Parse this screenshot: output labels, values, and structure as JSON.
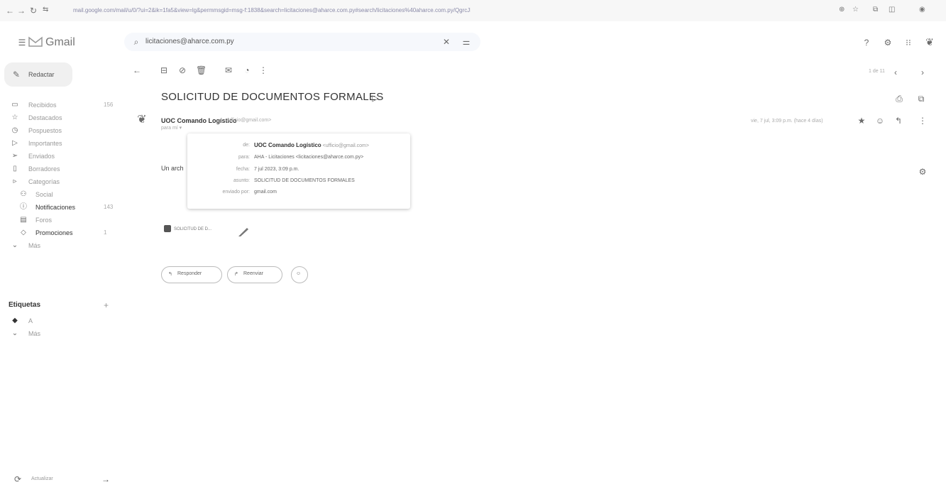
{
  "browser": {
    "url": "mail.google.com/mail/u/0/?ui=2&ik=1fa5&view=lg&permmsgid=msg-f:1838&search=licitaciones@aharce.com.py#search/licitaciones%40aharce.com.py/QgrcJHrThr..."
  },
  "app": {
    "title": "Gmail"
  },
  "search": {
    "value": "licitaciones@aharce.com.py"
  },
  "compose": {
    "label": "Redactar"
  },
  "sidebar": {
    "items": [
      {
        "label": "Recibidos",
        "count": "156",
        "icon": "inbox-icon"
      },
      {
        "label": "Destacados",
        "count": "",
        "icon": "star-icon"
      },
      {
        "label": "Pospuestos",
        "count": "",
        "icon": "clock-icon"
      },
      {
        "label": "Importantes",
        "count": "",
        "icon": "important-icon"
      },
      {
        "label": "Enviados",
        "count": "",
        "icon": "send-icon"
      },
      {
        "label": "Borradores",
        "count": "",
        "icon": "draft-icon"
      },
      {
        "label": "Categorías",
        "count": "",
        "icon": "category-icon"
      }
    ],
    "categories": [
      {
        "label": "Social",
        "count": "",
        "icon": "people-icon"
      },
      {
        "label": "Notificaciones",
        "count": "143",
        "icon": "info-icon"
      },
      {
        "label": "Foros",
        "count": "",
        "icon": "forum-icon"
      },
      {
        "label": "Promociones",
        "count": "1",
        "icon": "tag-icon"
      }
    ],
    "more": "Más",
    "labels_title": "Etiquetas",
    "labels": [
      {
        "label": "A"
      },
      {
        "label": "Más"
      }
    ],
    "update": "Actualizar"
  },
  "toolbar": {
    "pager": "1 de 11"
  },
  "email": {
    "subject": "SOLICITUD DE DOCUMENTOS FORMALES",
    "sender_name": "UOC Comando Logístico",
    "sender_email": "<ufficio@gmail.com>",
    "to_me": "para mí ▾",
    "date_right": "vie, 7 jul, 3:09 p.m. (hace 4 días)",
    "body_preview": "Un arch",
    "details": {
      "from_label": "de:",
      "from_name": "UOC Comando Logístico",
      "from_email": "<ufficio@gmail.com>",
      "to_label": "para:",
      "to_value": "AHA - Licitaciones <licitaciones@aharce.com.py>",
      "date_label": "fecha:",
      "date_value": "7 jul 2023, 3:09 p.m.",
      "subject_label": "asunto:",
      "subject_value": "SOLICITUD DE DOCUMENTOS FORMALES",
      "mailed_by_label": "enviado por:",
      "mailed_by_value": "gmail.com"
    },
    "attachment": "SOLICITUD DE D...",
    "reply_label": "Responder",
    "forward_label": "Reenviar"
  }
}
